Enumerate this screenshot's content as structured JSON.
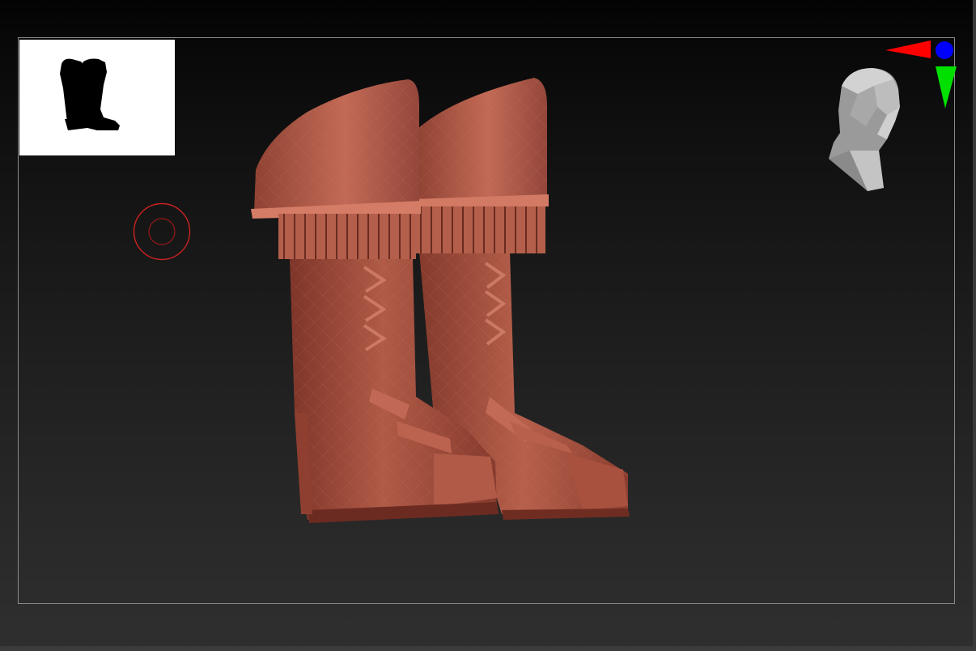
{
  "app": {
    "view": "3D viewport",
    "model_color": "#a5503f",
    "background_color": "#1c1c1c"
  },
  "thumbnail": {
    "icon": "boots-silhouette-icon",
    "background_color": "#ffffff"
  },
  "navigator": {
    "head_icon": "head-orientation-icon",
    "axes": [
      {
        "axis": "x",
        "color": "#ff0000",
        "icon": "x-axis-arrow-icon"
      },
      {
        "axis": "y",
        "color": "#00e000",
        "icon": "y-axis-arrow-icon"
      },
      {
        "axis": "z",
        "color": "#0000ff",
        "icon": "z-axis-dot-icon"
      }
    ]
  },
  "brush_cursor": {
    "icon": "brush-cursor-icon",
    "color": "#cc2222"
  }
}
